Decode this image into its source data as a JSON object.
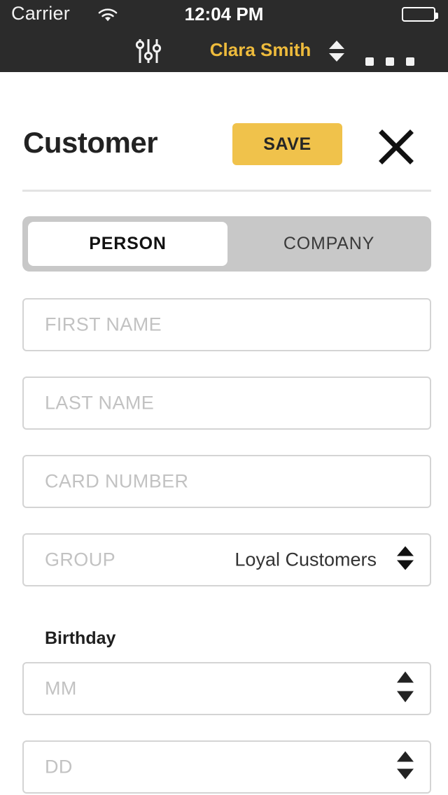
{
  "status_bar": {
    "carrier": "Carrier",
    "wifi_icon": "wifi-icon",
    "time": "12:04 PM",
    "battery_icon": "battery-full-icon"
  },
  "nav_bar": {
    "sliders_icon": "sliders-icon",
    "user_name": "Clara Smith",
    "user_stepper_icon": "stepper-up-down-icon",
    "more_icon": "more-options-icon",
    "accent_color": "#eebb3c",
    "background_color": "#2b2b2b"
  },
  "header": {
    "title": "Customer",
    "save_label": "SAVE",
    "save_color": "#f0c24b",
    "close_icon": "close-x-icon"
  },
  "segmented_control": {
    "selected": "PERSON",
    "options": [
      {
        "label": "PERSON",
        "active": true
      },
      {
        "label": "COMPANY",
        "active": false
      }
    ]
  },
  "form": {
    "fields": [
      {
        "name": "first-name",
        "placeholder": "FIRST NAME",
        "value": ""
      },
      {
        "name": "last-name",
        "placeholder": "LAST NAME",
        "value": ""
      },
      {
        "name": "card-number",
        "placeholder": "CARD NUMBER",
        "value": ""
      },
      {
        "name": "group",
        "placeholder": "GROUP",
        "value": "Loyal Customers",
        "stepper": true
      }
    ],
    "birthday": {
      "label": "Birthday",
      "month": {
        "placeholder": "MM",
        "value": "",
        "stepper": true
      },
      "day": {
        "placeholder": "DD",
        "value": "",
        "stepper": true
      }
    }
  }
}
